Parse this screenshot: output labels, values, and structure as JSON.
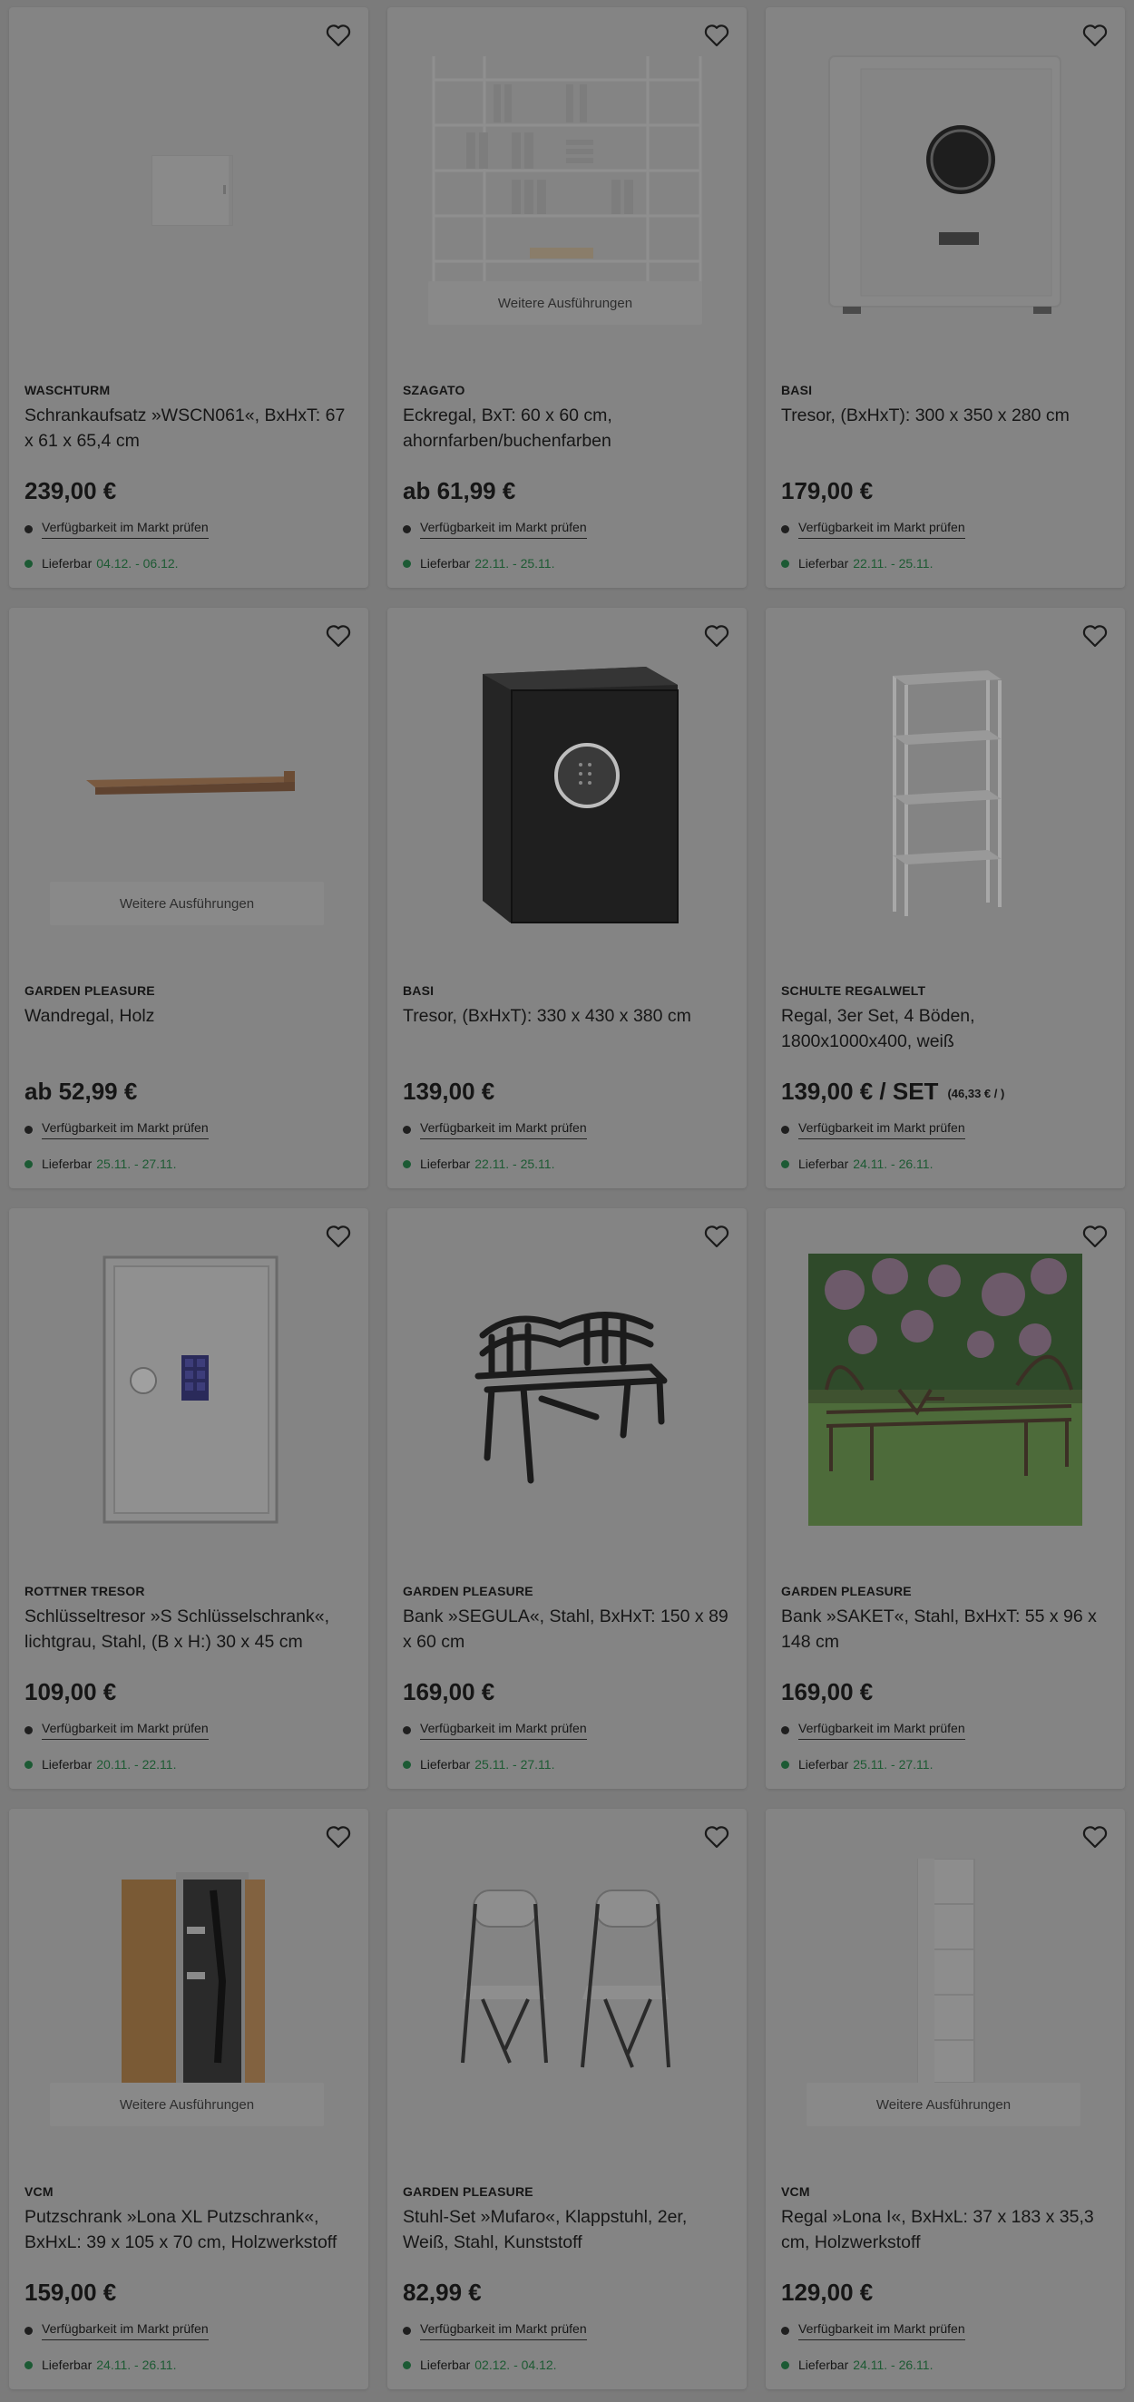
{
  "common": {
    "availability_label": "Verfügbarkeit im Markt prüfen",
    "delivery_label": "Lieferbar",
    "variants_label": "Weitere Ausführungen"
  },
  "products": [
    {
      "brand": "WASCHTURM",
      "title": "Schrankaufsatz »WSCN061«, BxHxT: 67 x 61 x 65,4 cm",
      "price": "239,00 €",
      "delivery": "04.12. - 06.12.",
      "image": "wall-cabinet-image"
    },
    {
      "brand": "SZAGATO",
      "title": "Eckregal, BxT: 60 x 60 cm, ahornfarben/buchenfarben",
      "price": "ab 61,99 €",
      "delivery": "22.11. - 25.11.",
      "image": "corner-shelf-image"
    },
    {
      "brand": "BASI",
      "title": "Tresor, (BxHxT): 300 x 350 x 280 cm",
      "price": "179,00 €",
      "delivery": "22.11. - 25.11.",
      "image": "safe-image"
    },
    {
      "brand": "GARDEN PLEASURE",
      "title": "Wandregal, Holz",
      "price": "ab 52,99 €",
      "delivery": "25.11. - 27.11.",
      "image": "wall-shelf-image"
    },
    {
      "brand": "BASI",
      "title": "Tresor, (BxHxT): 330 x 430 x 380 cm",
      "price": "139,00 €",
      "delivery": "22.11. - 25.11.",
      "image": "black-safe-image"
    },
    {
      "brand": "SCHULTE REGALWELT",
      "title": "Regal, 3er Set, 4 Böden, 1800x1000x400, weiß",
      "price": "139,00 € / SET",
      "unit_price": "(46,33 € / )",
      "delivery": "24.11. - 26.11.",
      "image": "metal-shelf-image"
    },
    {
      "brand": "ROTTNER TRESOR",
      "title": "Schlüsseltresor »S Schlüsselschrank«, lichtgrau, Stahl, (B x H:) 30 x 45 cm",
      "price": "109,00 €",
      "delivery": "20.11. - 22.11.",
      "image": "key-safe-image"
    },
    {
      "brand": "GARDEN PLEASURE",
      "title": "Bank »SEGULA«, Stahl, BxHxT: 150 x 89 x 60 cm",
      "price": "169,00 €",
      "delivery": "25.11. - 27.11.",
      "image": "bench-image"
    },
    {
      "brand": "GARDEN PLEASURE",
      "title": "Bank »SAKET«, Stahl, BxHxT: 55 x 96 x 148 cm",
      "price": "169,00 €",
      "delivery": "25.11. - 27.11.",
      "image": "garden-bench-photo"
    },
    {
      "brand": "VCM",
      "title": "Putzschrank »Lona XL Putzschrank«, BxHxL: 39 x 105 x 70 cm, Holzwerkstoff",
      "price": "159,00 €",
      "delivery": "24.11. - 26.11.",
      "image": "cleaning-cabinet-image"
    },
    {
      "brand": "GARDEN PLEASURE",
      "title": "Stuhl-Set »Mufaro«, Klappstuhl, 2er, Weiß, Stahl, Kunststoff",
      "price": "82,99 €",
      "delivery": "02.12. - 04.12.",
      "image": "folding-chairs-image"
    },
    {
      "brand": "VCM",
      "title": "Regal »Lona I«, BxHxL: 37 x 183 x 35,3 cm, Holzwerkstoff",
      "price": "129,00 €",
      "delivery": "24.11. - 26.11.",
      "image": "tall-shelf-image"
    }
  ],
  "colors": {
    "overlay_bg": "#7b7b7b",
    "card_bg": "#848484",
    "delivery_green": "#1d5a33",
    "text": "#161616"
  }
}
